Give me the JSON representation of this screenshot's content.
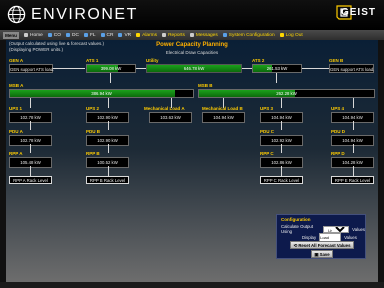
{
  "brand": {
    "name": "ENVIRONET",
    "vendor": "GEIST"
  },
  "nav": {
    "menu_label": "Menu",
    "items": [
      {
        "label": "Home",
        "icon": "home-icon"
      },
      {
        "label": "CO",
        "icon": "co-icon"
      },
      {
        "label": "DC",
        "icon": "dc-icon"
      },
      {
        "label": "FL",
        "icon": "fl-icon"
      },
      {
        "label": "CR",
        "icon": "cr-icon"
      },
      {
        "label": "VR",
        "icon": "vr-icon"
      },
      {
        "label": "Alarms",
        "icon": "alarm-icon"
      },
      {
        "label": "Reports",
        "icon": "report-icon"
      },
      {
        "label": "Messages",
        "icon": "message-icon"
      },
      {
        "label": "System Configuration",
        "icon": "config-icon"
      },
      {
        "label": "Log Out",
        "icon": "logout-icon"
      }
    ],
    "highlight_color": "#ffd700"
  },
  "page": {
    "note1": "(Output calculated using live & forecast values.)",
    "note2": "(Displaying POWER units.)",
    "title": "Power Capacity Planning",
    "subtitle": "Electrical Draw Capacities"
  },
  "diagram": {
    "gen_a": {
      "label": "GEN A",
      "value": "GEN support ATS load."
    },
    "ats_1": {
      "label": "ATS 1",
      "value": "399.08 kW",
      "fill": 0.65
    },
    "utility": {
      "label": "Utility",
      "value": "646.78 kW"
    },
    "ats_2": {
      "label": "ATS 2",
      "value": "261.53 kW",
      "fill": 0.4
    },
    "gen_b": {
      "label": "GEN B",
      "value": "GEN support ATS load."
    },
    "msb_a": {
      "label": "MSB A",
      "value": "386.94 kW",
      "fill": 0.9
    },
    "msb_b": {
      "label": "MSB B",
      "value": "262.28 kW",
      "fill": 0.55
    },
    "ups": [
      {
        "label": "UPS 1",
        "value": "102.78 kW"
      },
      {
        "label": "UPS 2",
        "value": "102.90 kW"
      },
      {
        "label": "Mechanical Load A",
        "value": "103.63 kW"
      },
      {
        "label": "Mechanical Load B",
        "value": "104.94 kW"
      },
      {
        "label": "UPS 3",
        "value": "104.94 kW"
      },
      {
        "label": "UPS 4",
        "value": "104.94 kW"
      }
    ],
    "pdu": [
      {
        "label": "PDU A",
        "value": "102.78 kW"
      },
      {
        "label": "PDU B",
        "value": "102.90 kW"
      },
      {
        "label": "PDU C",
        "value": "102.92 kW"
      },
      {
        "label": "PDU D",
        "value": "104.94 kW"
      }
    ],
    "rpp": [
      {
        "label": "RPP A",
        "value": "105.48 kW"
      },
      {
        "label": "RPP B",
        "value": "100.52 kW"
      },
      {
        "label": "RPP C",
        "value": "102.86 kW"
      },
      {
        "label": "RPP D",
        "value": "104.28 kW"
      }
    ],
    "rack_links": [
      "RPP A Rack Level",
      "RPP B Rack Level",
      "RPP C Rack Level",
      "RPP E Rack Level"
    ]
  },
  "config": {
    "title": "Configuration",
    "calc_label": "Calculate Output Using",
    "calc_value": "Live",
    "calc_suffix": "Values",
    "display_label": "Display",
    "display_value": "Load",
    "display_suffix": "Values",
    "reset_label": "Reset All Forecast Values",
    "save_label": "Save"
  }
}
